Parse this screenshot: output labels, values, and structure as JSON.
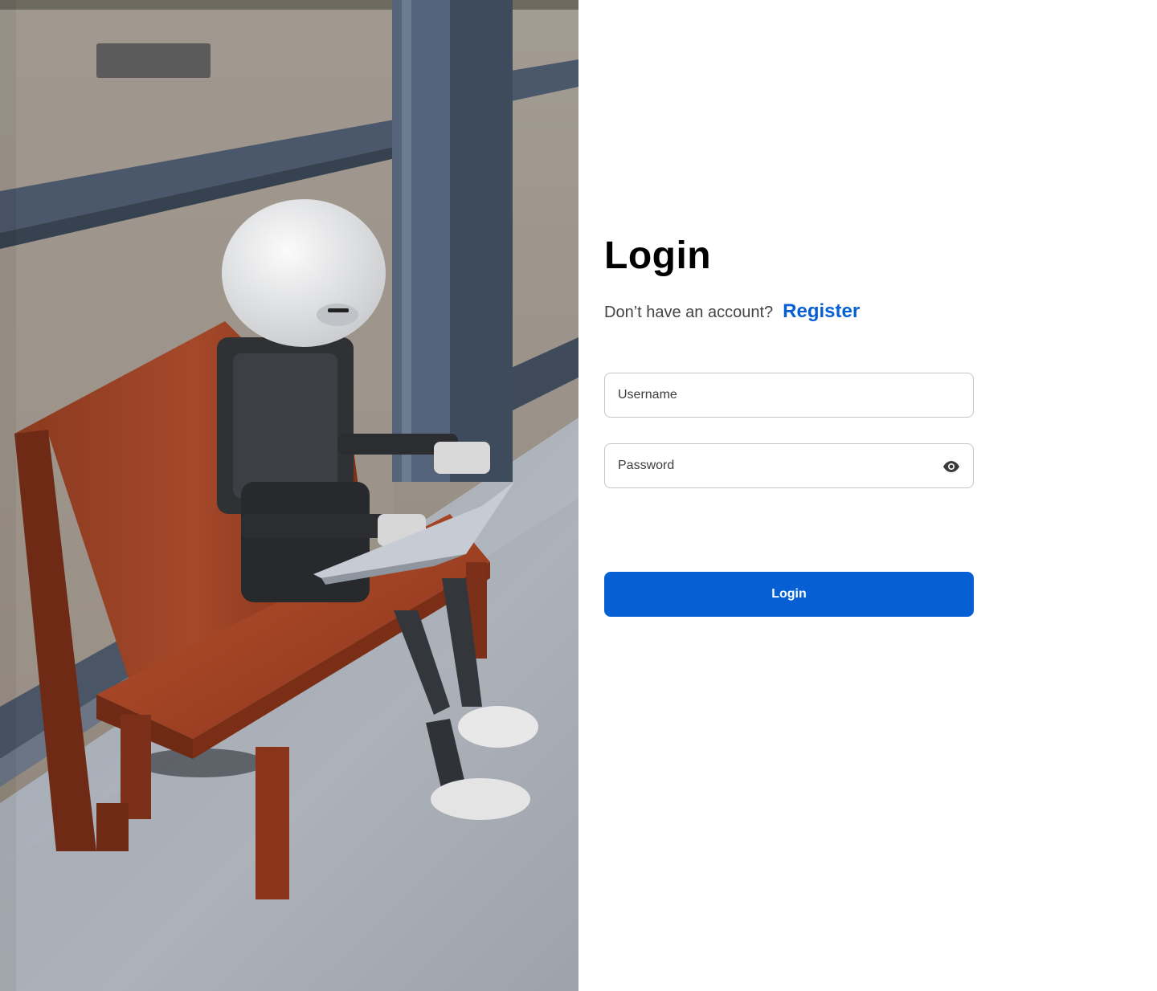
{
  "branding": {
    "logo_icon": "logo-placeholder"
  },
  "login": {
    "title": "Login",
    "register_prompt": "Don’t have an account?",
    "register_link": "Register",
    "username": {
      "placeholder": "Username",
      "value": ""
    },
    "password": {
      "placeholder": "Password",
      "value": "",
      "toggle_icon": "eye-icon"
    },
    "submit_label": "Login"
  },
  "hero_image": {
    "subject_icon": "robot-on-bench-photo"
  },
  "colors": {
    "accent": "#0760d3",
    "title_text": "#000000",
    "prompt_text": "#444444",
    "field_border": "#c6c6c6",
    "logo_placeholder": "#5b5b5b"
  }
}
